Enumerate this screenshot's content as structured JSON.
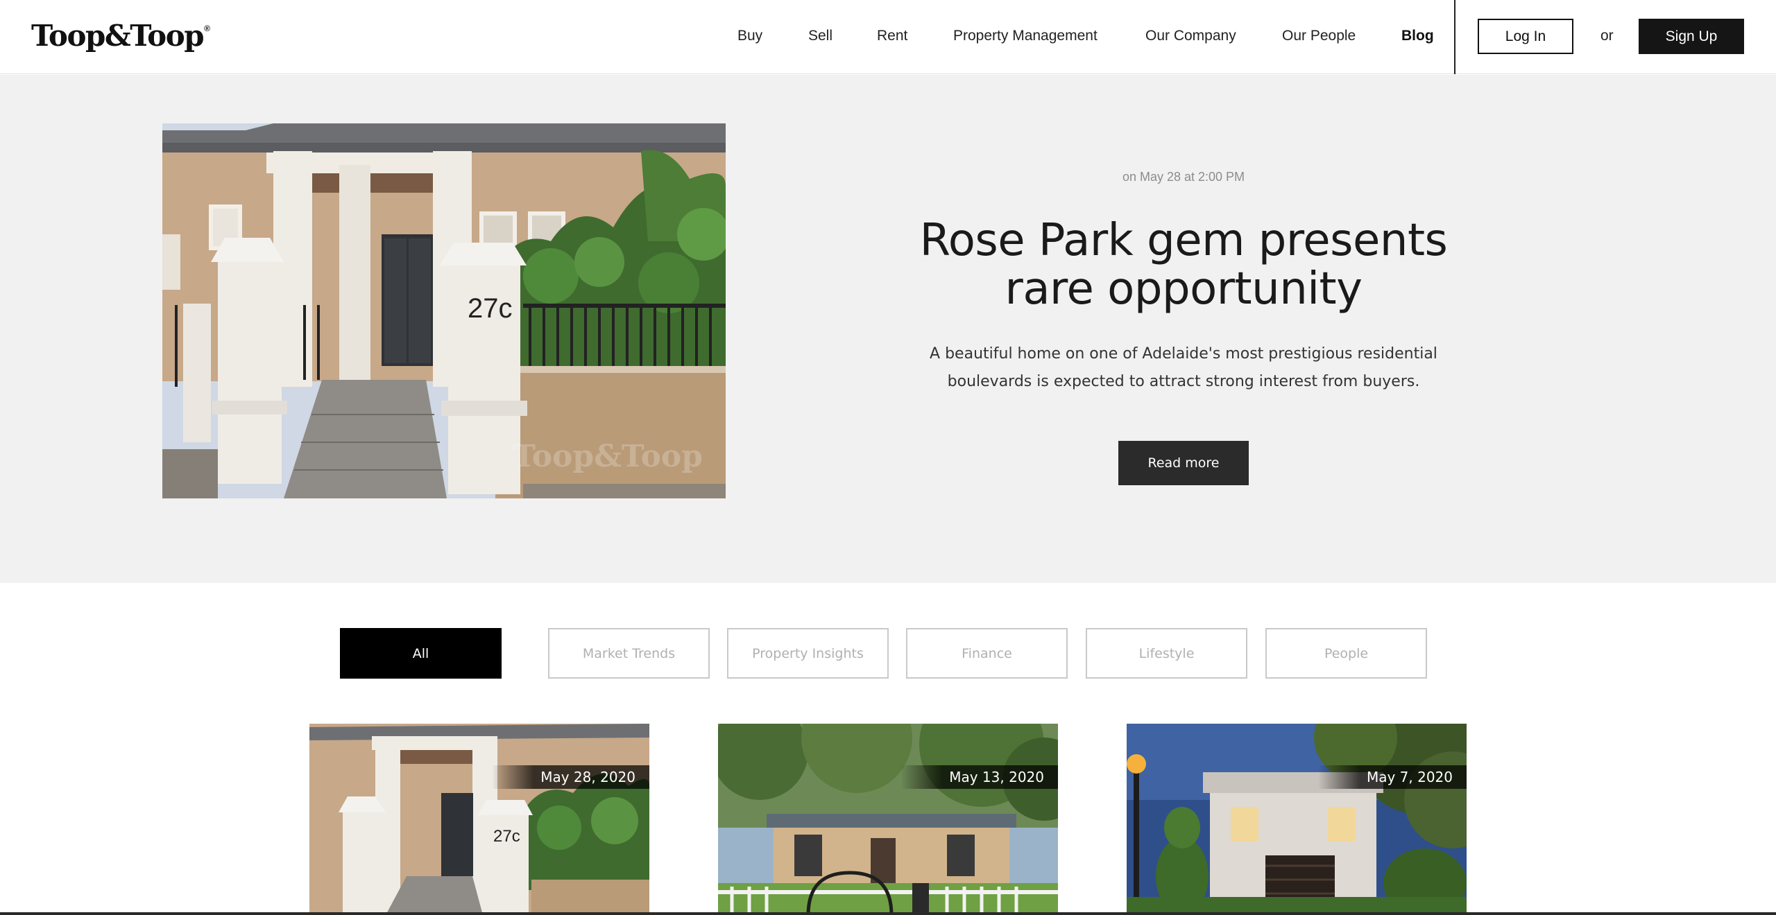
{
  "header": {
    "logo_text": "Toop&Toop",
    "logo_mark": "®",
    "nav": [
      {
        "label": "Buy"
      },
      {
        "label": "Sell"
      },
      {
        "label": "Rent"
      },
      {
        "label": "Property Management"
      },
      {
        "label": "Our Company"
      },
      {
        "label": "Our People"
      },
      {
        "label": "Blog",
        "active": true
      }
    ],
    "login_label": "Log In",
    "or_label": "or",
    "signup_label": "Sign Up"
  },
  "hero": {
    "date": "on May 28 at 2:00 PM",
    "title": "Rose Park gem presents rare opportunity",
    "excerpt": "A beautiful home on one of Adelaide's most prestigious residential boulevards is expected to attract strong interest from buyers.",
    "read_more_label": "Read more",
    "house_number": "27c",
    "watermark": "Toop&Toop"
  },
  "filters": [
    {
      "label": "All",
      "active": true
    },
    {
      "label": "Market Trends"
    },
    {
      "label": "Property Insights"
    },
    {
      "label": "Finance"
    },
    {
      "label": "Lifestyle"
    },
    {
      "label": "People"
    }
  ],
  "cards": [
    {
      "date": "May 28, 2020",
      "house_number": "27c"
    },
    {
      "date": "May 13, 2020"
    },
    {
      "date": "May 7, 2020"
    }
  ],
  "colors": {
    "hero_bg": "#f1f1f1",
    "button_dark": "#2b2b2b",
    "filter_active": "#000000",
    "filter_inactive_text": "#b0b0b0"
  }
}
